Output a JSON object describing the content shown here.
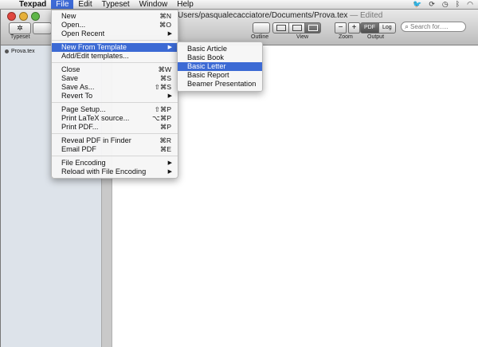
{
  "menubar": {
    "apple_icon": "apple-icon",
    "items": [
      {
        "label": "Texpad"
      },
      {
        "label": "File"
      },
      {
        "label": "Edit"
      },
      {
        "label": "Typeset"
      },
      {
        "label": "Window"
      },
      {
        "label": "Help"
      }
    ],
    "tray": [
      "twitter-icon",
      "sync-icon",
      "clock-icon",
      "bluetooth-icon",
      "wifi-icon"
    ]
  },
  "window": {
    "title_path": "Users/pasqualecacciatore/Documents/Prova.tex",
    "title_edited": "— Edited",
    "toolbar": {
      "typeset_label": "Typeset",
      "outline_label": "Outline",
      "view_label": "View",
      "zoom_label": "Zoom",
      "zoom_out": "−",
      "zoom_in": "+",
      "output_label": "Output",
      "output_pdf": "PDF",
      "output_log": "Log",
      "search_placeholder": "Search for....."
    },
    "sidebar": {
      "file_name": "Prova.tex"
    }
  },
  "file_menu": {
    "items": [
      {
        "label": "New",
        "shortcut": "⌘N"
      },
      {
        "label": "Open...",
        "shortcut": "⌘O"
      },
      {
        "label": "Open Recent",
        "shortcut": "▶"
      },
      {
        "label": "New From Template",
        "shortcut": "▶"
      },
      {
        "label": "Add/Edit templates...",
        "shortcut": ""
      },
      {
        "label": "Close",
        "shortcut": "⌘W"
      },
      {
        "label": "Save",
        "shortcut": "⌘S"
      },
      {
        "label": "Save As...",
        "shortcut": "⇧⌘S"
      },
      {
        "label": "Revert To",
        "shortcut": "▶"
      },
      {
        "label": "Page Setup...",
        "shortcut": "⇧⌘P"
      },
      {
        "label": "Print LaTeX source...",
        "shortcut": "⌥⌘P"
      },
      {
        "label": "Print PDF...",
        "shortcut": "⌘P"
      },
      {
        "label": "Reveal PDF in Finder",
        "shortcut": "⌘R"
      },
      {
        "label": "Email PDF",
        "shortcut": "⌘E"
      },
      {
        "label": "File Encoding",
        "shortcut": "▶"
      },
      {
        "label": "Reload with File Encoding",
        "shortcut": "▶"
      }
    ]
  },
  "template_menu": {
    "items": [
      {
        "label": "Basic Article"
      },
      {
        "label": "Basic Book"
      },
      {
        "label": "Basic Letter"
      },
      {
        "label": "Basic Report"
      },
      {
        "label": "Beamer Presentation"
      }
    ]
  },
  "colors": {
    "highlight": "#3c6ad4",
    "menubar": "#e6e6e6",
    "sidebar": "#dde3ea"
  }
}
